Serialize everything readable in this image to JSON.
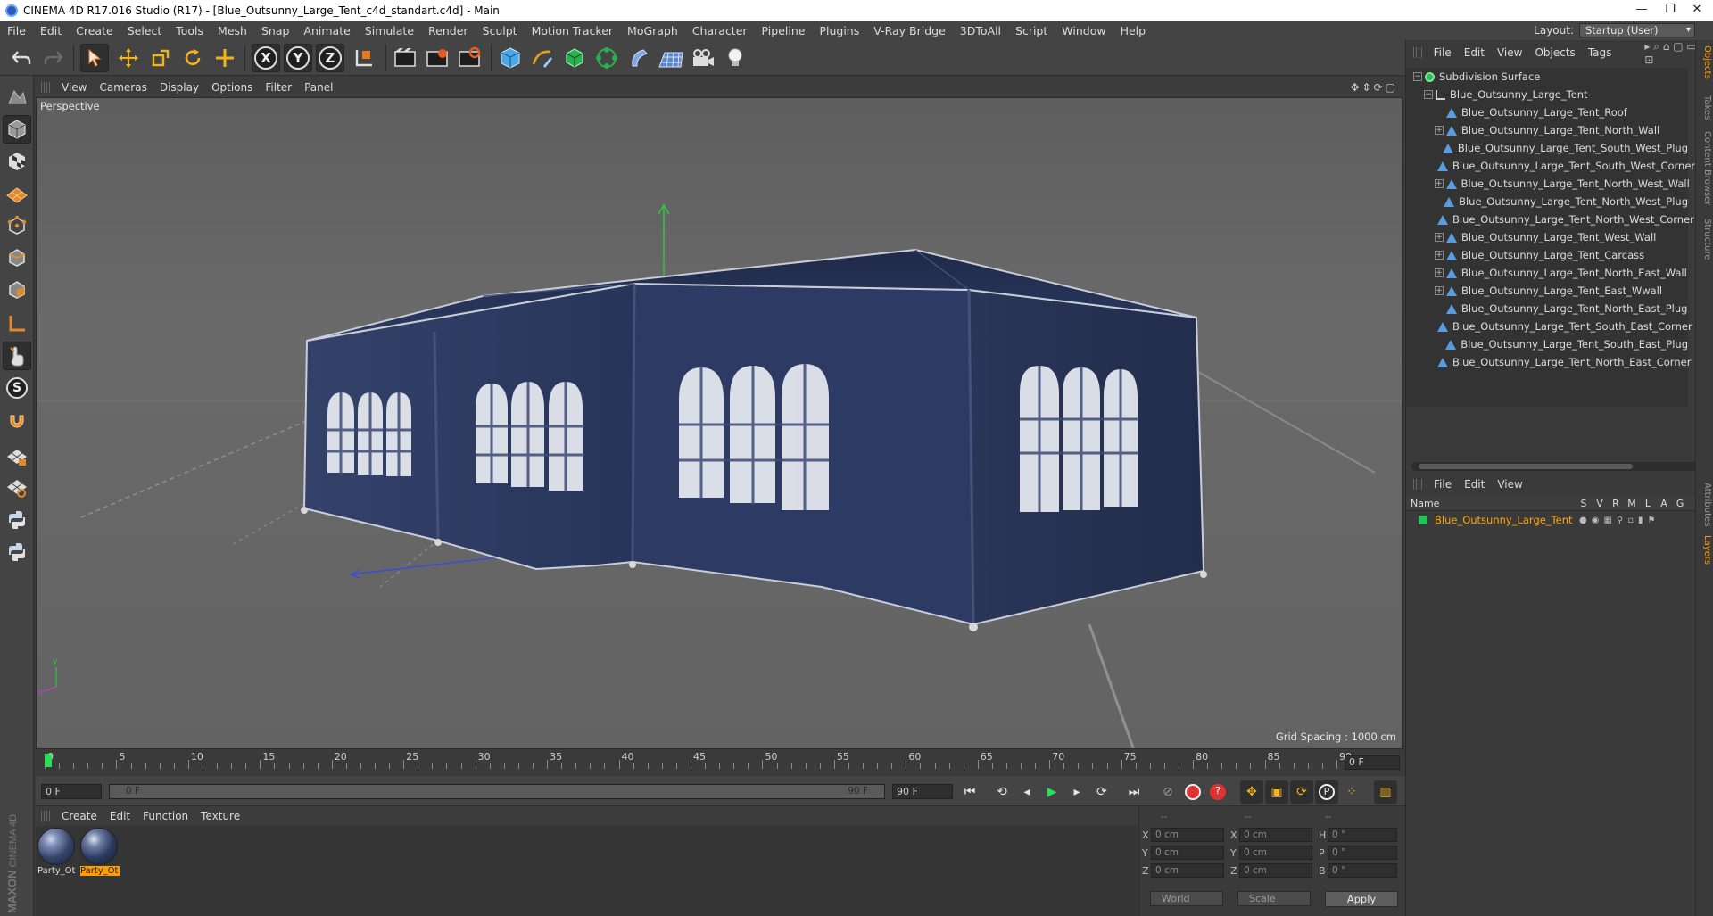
{
  "window": {
    "title": "CINEMA 4D R17.016 Studio (R17) - [Blue_Outsunny_Large_Tent_c4d_standart.c4d] - Main",
    "controls": [
      "—",
      "❐",
      "✕"
    ]
  },
  "menu": [
    "File",
    "Edit",
    "Create",
    "Select",
    "Tools",
    "Mesh",
    "Snap",
    "Animate",
    "Simulate",
    "Render",
    "Sculpt",
    "Motion Tracker",
    "MoGraph",
    "Character",
    "Pipeline",
    "Plugins",
    "V-Ray Bridge",
    "3DToAll",
    "Script",
    "Window",
    "Help"
  ],
  "layout": {
    "label": "Layout:",
    "value": "Startup (User)"
  },
  "toolbar": {
    "axis_x": "X",
    "axis_y": "Y",
    "axis_z": "Z"
  },
  "viewport": {
    "menu": [
      "View",
      "Cameras",
      "Display",
      "Options",
      "Filter",
      "Panel"
    ],
    "label": "Perspective",
    "grid_spacing": "Grid Spacing : 1000 cm",
    "axis_y": "y",
    "axis_x": "x"
  },
  "objects_panel": {
    "menu": [
      "File",
      "Edit",
      "View",
      "Objects",
      "Tags"
    ],
    "items": [
      {
        "label": "Subdivision Surface",
        "depth": 0,
        "icon": "subdivision-icon",
        "expander": "−"
      },
      {
        "label": "Blue_Outsunny_Large_Tent",
        "depth": 1,
        "icon": "null-icon",
        "expander": "−"
      },
      {
        "label": "Blue_Outsunny_Large_Tent_Roof",
        "depth": 2,
        "icon": "polygon-icon",
        "expander": ""
      },
      {
        "label": "Blue_Outsunny_Large_Tent_North_Wall",
        "depth": 2,
        "icon": "polygon-icon",
        "expander": "+"
      },
      {
        "label": "Blue_Outsunny_Large_Tent_South_West_Plug",
        "depth": 2,
        "icon": "polygon-icon",
        "expander": ""
      },
      {
        "label": "Blue_Outsunny_Large_Tent_South_West_Corner",
        "depth": 2,
        "icon": "polygon-icon",
        "expander": ""
      },
      {
        "label": "Blue_Outsunny_Large_Tent_North_West_Wall",
        "depth": 2,
        "icon": "polygon-icon",
        "expander": "+"
      },
      {
        "label": "Blue_Outsunny_Large_Tent_North_West_Plug",
        "depth": 2,
        "icon": "polygon-icon",
        "expander": ""
      },
      {
        "label": "Blue_Outsunny_Large_Tent_North_West_Corner",
        "depth": 2,
        "icon": "polygon-icon",
        "expander": ""
      },
      {
        "label": "Blue_Outsunny_Large_Tent_West_Wall",
        "depth": 2,
        "icon": "polygon-icon",
        "expander": "+"
      },
      {
        "label": "Blue_Outsunny_Large_Tent_Carcass",
        "depth": 2,
        "icon": "polygon-icon",
        "expander": "+"
      },
      {
        "label": "Blue_Outsunny_Large_Tent_North_East_Wall",
        "depth": 2,
        "icon": "polygon-icon",
        "expander": "+"
      },
      {
        "label": "Blue_Outsunny_Large_Tent_East_Wwall",
        "depth": 2,
        "icon": "polygon-icon",
        "expander": "+"
      },
      {
        "label": "Blue_Outsunny_Large_Tent_North_East_Plug",
        "depth": 2,
        "icon": "polygon-icon",
        "expander": ""
      },
      {
        "label": "Blue_Outsunny_Large_Tent_South_East_Corner",
        "depth": 2,
        "icon": "polygon-icon",
        "expander": ""
      },
      {
        "label": "Blue_Outsunny_Large_Tent_South_East_Plug",
        "depth": 2,
        "icon": "polygon-icon",
        "expander": ""
      },
      {
        "label": "Blue_Outsunny_Large_Tent_North_East_Corner",
        "depth": 2,
        "icon": "polygon-icon",
        "expander": ""
      }
    ]
  },
  "side_tabs": [
    "Objects",
    "Takes",
    "Content Browser",
    "Structure"
  ],
  "side_tabs_lower": [
    "Attributes",
    "Layers"
  ],
  "layers_panel": {
    "menu": [
      "File",
      "Edit",
      "View"
    ],
    "columns": [
      "Name",
      "S",
      "V",
      "R",
      "M",
      "L",
      "A",
      "G"
    ],
    "row": "Blue_Outsunny_Large_Tent"
  },
  "timeline": {
    "ticks": [
      "0",
      "5",
      "10",
      "15",
      "20",
      "25",
      "30",
      "35",
      "40",
      "45",
      "50",
      "55",
      "60",
      "65",
      "70",
      "75",
      "80",
      "85",
      "90"
    ],
    "frame_field": "0 F"
  },
  "transport": {
    "start_field": "0 F",
    "slider_left": "0 F",
    "slider_right": "90 F",
    "end_field": "90 F"
  },
  "materials": {
    "menu": [
      "Create",
      "Edit",
      "Function",
      "Texture"
    ],
    "items": [
      {
        "label": "Party_Ot",
        "selected": false
      },
      {
        "label": "Party_Ot",
        "selected": true
      }
    ]
  },
  "coordinates": {
    "headers": [
      "--",
      "--",
      "--"
    ],
    "rows": [
      {
        "a": "X",
        "av": "0 cm",
        "b": "X",
        "bv": "0 cm",
        "c": "H",
        "cv": "0 °"
      },
      {
        "a": "Y",
        "av": "0 cm",
        "b": "Y",
        "bv": "0 cm",
        "c": "P",
        "cv": "0 °"
      },
      {
        "a": "Z",
        "av": "0 cm",
        "b": "Z",
        "bv": "0 cm",
        "c": "B",
        "cv": "0 °"
      }
    ],
    "mode": "World",
    "size_mode": "Scale",
    "apply": "Apply"
  },
  "colors": {
    "accent_orange": "#ff9e00",
    "tag_green": "#26c05a",
    "tent_blue": "#2b3a5c"
  }
}
